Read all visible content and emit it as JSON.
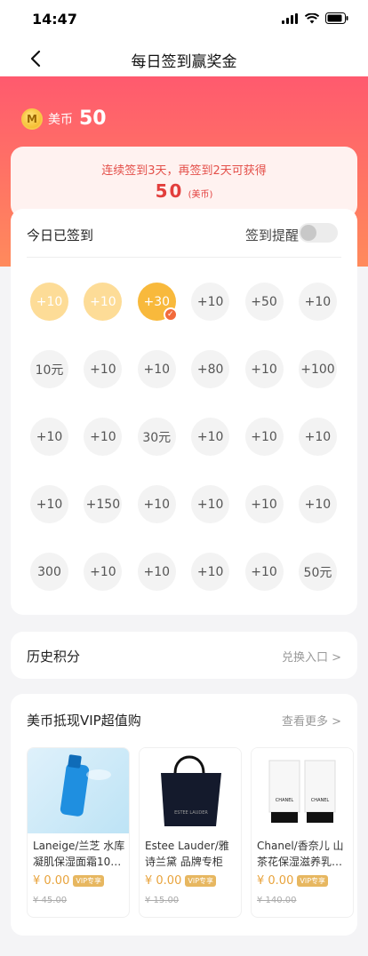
{
  "status": {
    "time": "14:47"
  },
  "nav": {
    "title": "每日签到赢奖金"
  },
  "balance": {
    "label": "美币",
    "value": "50",
    "coin_letter": "M"
  },
  "promo": {
    "text": "连续签到3天，再签到2天可获得",
    "reward_value": "50",
    "reward_unit": "(美币)"
  },
  "checkin": {
    "title": "今日已签到",
    "reminder_label": "签到提醒",
    "reminder_on": false,
    "days": [
      "+10",
      "+10",
      "+30",
      "+10",
      "+50",
      "+10",
      "10元",
      "+10",
      "+10",
      "+80",
      "+10",
      "+100",
      "+10",
      "+10",
      "30元",
      "+10",
      "+10",
      "+10",
      "+10",
      "+150",
      "+10",
      "+10",
      "+10",
      "+10",
      "300",
      "+10",
      "+10",
      "+10",
      "+10",
      "50元"
    ],
    "signed_count": 3
  },
  "history": {
    "title": "历史积分",
    "link": "兑换入口 >"
  },
  "vip": {
    "title": "美币抵现VIP超值购",
    "more": "查看更多 >",
    "products": [
      {
        "name": "Laneige/兰芝 水库凝肌保湿面霜10…",
        "price": "¥ 0.00",
        "badge": "VIP专享",
        "orig": "¥ 45.00"
      },
      {
        "name": "Estee Lauder/雅诗兰黛 品牌专柜袋…",
        "price": "¥ 0.00",
        "badge": "VIP专享",
        "orig": "¥ 15.00"
      },
      {
        "name": "Chanel/香奈儿 山茶花保湿滋养乳…",
        "price": "¥ 0.00",
        "badge": "VIP专享",
        "orig": "¥ 140.00"
      }
    ],
    "img_text": {
      "estee": "ESTEE LAUDER",
      "chanel": "CHANEL"
    }
  }
}
